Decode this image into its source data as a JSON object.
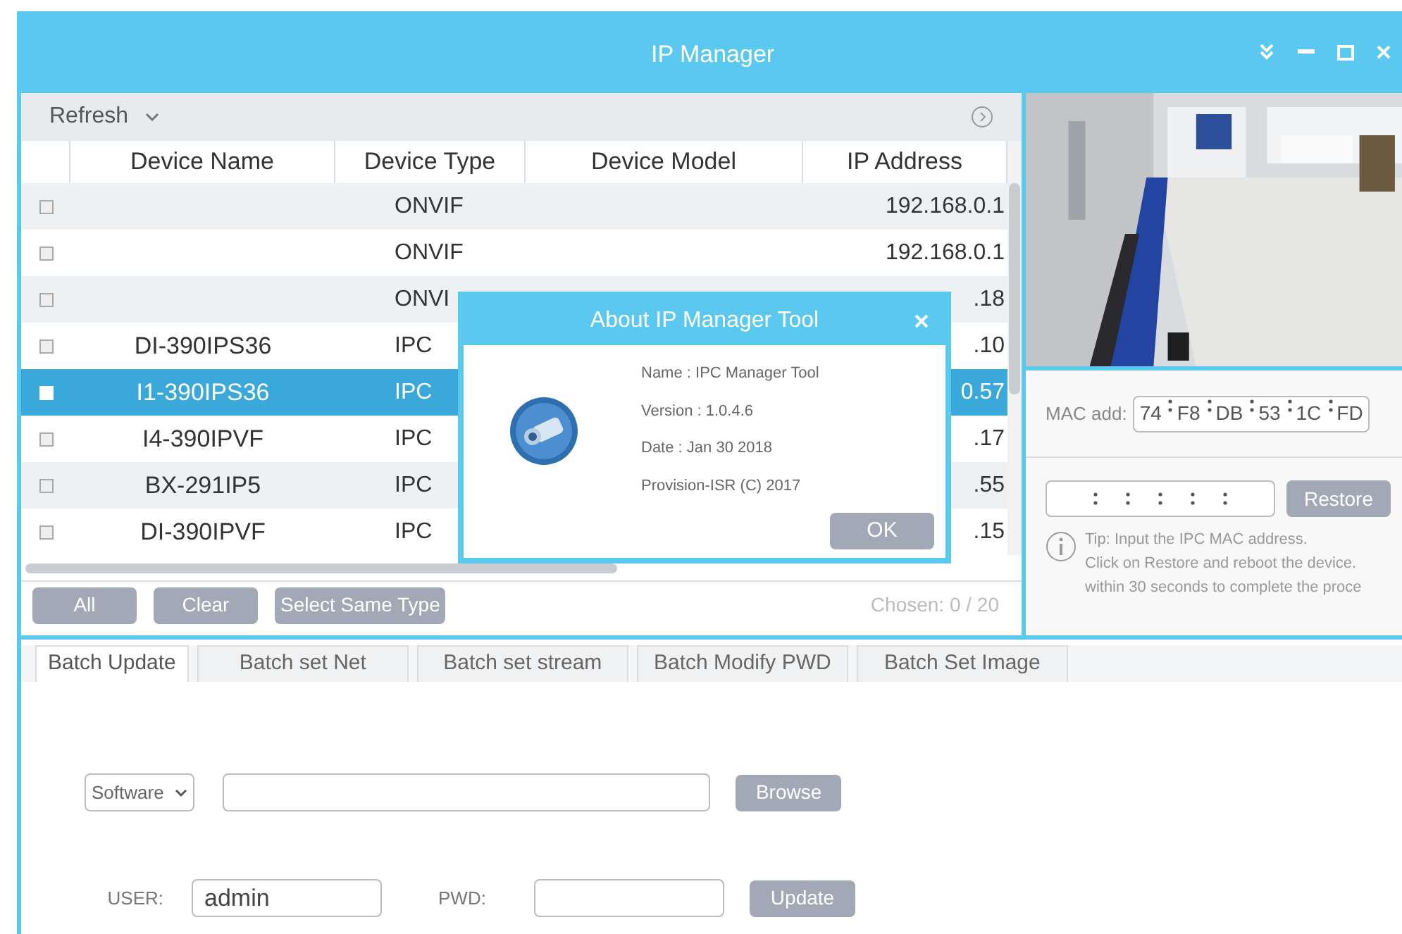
{
  "window": {
    "title": "IP Manager"
  },
  "toolbar": {
    "refresh": "Refresh"
  },
  "table": {
    "columns": [
      "Device Name",
      "Device Type",
      "Device Model",
      "IP Address"
    ],
    "rows": [
      {
        "checked": false,
        "selected": false,
        "name": "",
        "type": "ONVIF",
        "ip": "192.168.0.1"
      },
      {
        "checked": false,
        "selected": false,
        "name": "",
        "type": "ONVIF",
        "ip": "192.168.0.1"
      },
      {
        "checked": false,
        "selected": false,
        "name": "",
        "type": "ONVI",
        "ip": ".18"
      },
      {
        "checked": false,
        "selected": false,
        "name": "DI-390IPS36",
        "type": "IPC",
        "ip": ".10"
      },
      {
        "checked": false,
        "selected": true,
        "name": "I1-390IPS36",
        "type": "IPC",
        "ip": "0.57"
      },
      {
        "checked": false,
        "selected": false,
        "name": "I4-390IPVF",
        "type": "IPC",
        "ip": ".17"
      },
      {
        "checked": false,
        "selected": false,
        "name": "BX-291IP5",
        "type": "IPC",
        "ip": ".55"
      },
      {
        "checked": false,
        "selected": false,
        "name": "DI-390IPVF",
        "type": "IPC",
        "ip": ".15"
      }
    ]
  },
  "actions": [
    "All",
    "Clear",
    "Select Same Type"
  ],
  "chosen": {
    "label": "Chosen:",
    "value": "0 / 20"
  },
  "tabs": [
    {
      "label": "Batch Update",
      "selected": true
    },
    {
      "label": "Batch set Net",
      "selected": false
    },
    {
      "label": "Batch set stream",
      "selected": false
    },
    {
      "label": "Batch Modify PWD",
      "selected": false
    },
    {
      "label": "Batch Set Image",
      "selected": false
    }
  ],
  "update_form": {
    "source": "Software",
    "browse": "Browse",
    "user_label": "USER:",
    "user": "admin",
    "pwd_label": "PWD:",
    "update": "Update"
  },
  "restore_panel": {
    "mac_label": "MAC add:",
    "mac": [
      "74",
      "F8",
      "DB",
      "53",
      "1C",
      "FD"
    ],
    "restore": "Restore",
    "tip": [
      "Tip: Input the IPC MAC address.",
      "Click on Restore and reboot the device.",
      "within 30 seconds to complete the proce"
    ]
  },
  "dialog": {
    "title": "About IP Manager Tool",
    "lines": [
      "Name : IPC Manager Tool",
      "Version : 1.0.4.6",
      "Date : Jan 30 2018",
      "Provision-ISR (C) 2017"
    ],
    "ok": "OK"
  }
}
